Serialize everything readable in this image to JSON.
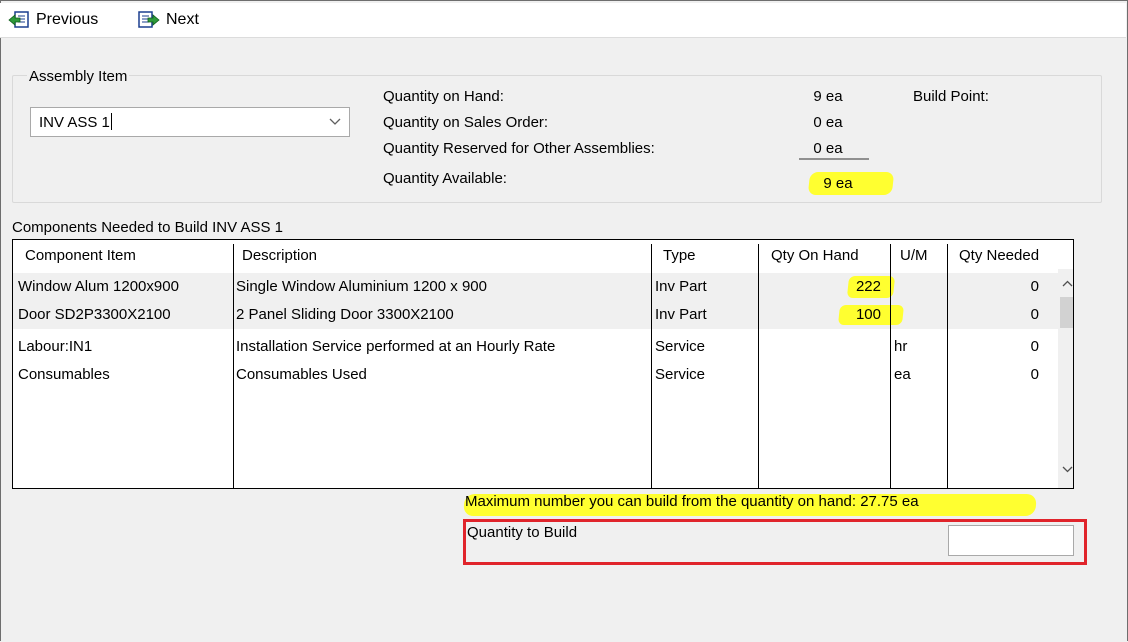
{
  "toolbar": {
    "previous_label": "Previous",
    "next_label": "Next",
    "previous_icon": "previous-icon",
    "next_icon": "next-icon"
  },
  "assembly": {
    "legend": "Assembly Item",
    "selected_value": "INV ASS 1",
    "stats": [
      {
        "label": "Quantity on Hand:",
        "value": "9 ea"
      },
      {
        "label": "Quantity on Sales Order:",
        "value": "0 ea"
      },
      {
        "label": "Quantity Reserved for Other Assemblies:",
        "value": "0 ea"
      },
      {
        "label": "Quantity Available:",
        "value": "9 ea"
      }
    ],
    "build_point_label": "Build Point:"
  },
  "components": {
    "caption": "Components Needed to Build  INV ASS 1",
    "columns": [
      "Component Item",
      "Description",
      "Type",
      "Qty On Hand",
      "U/M",
      "Qty Needed"
    ],
    "rows": [
      {
        "item": "Window Alum 1200x900",
        "description": "Single Window Aluminium 1200 x 900",
        "type": "Inv Part",
        "qty_on_hand": "222",
        "um": "",
        "qty_needed": "0"
      },
      {
        "item": "Door SD2P3300X2100",
        "description": "2 Panel Sliding Door 3300X2100",
        "type": "Inv Part",
        "qty_on_hand": "100",
        "um": "",
        "qty_needed": "0"
      },
      {
        "item": "Labour:IN1",
        "description": "Installation Service performed at an Hourly Rate",
        "type": "Service",
        "qty_on_hand": "",
        "um": "hr",
        "qty_needed": "0"
      },
      {
        "item": "Consumables",
        "description": "Consumables Used",
        "type": "Service",
        "qty_on_hand": "",
        "um": "ea",
        "qty_needed": "0"
      }
    ]
  },
  "max_build_text": "Maximum number you can build from the quantity on hand: 27.75 ea",
  "quantity_to_build": {
    "label": "Quantity to Build",
    "value": ""
  },
  "colors": {
    "highlight": "#ffff30",
    "annotation_box": "#e0242b"
  }
}
